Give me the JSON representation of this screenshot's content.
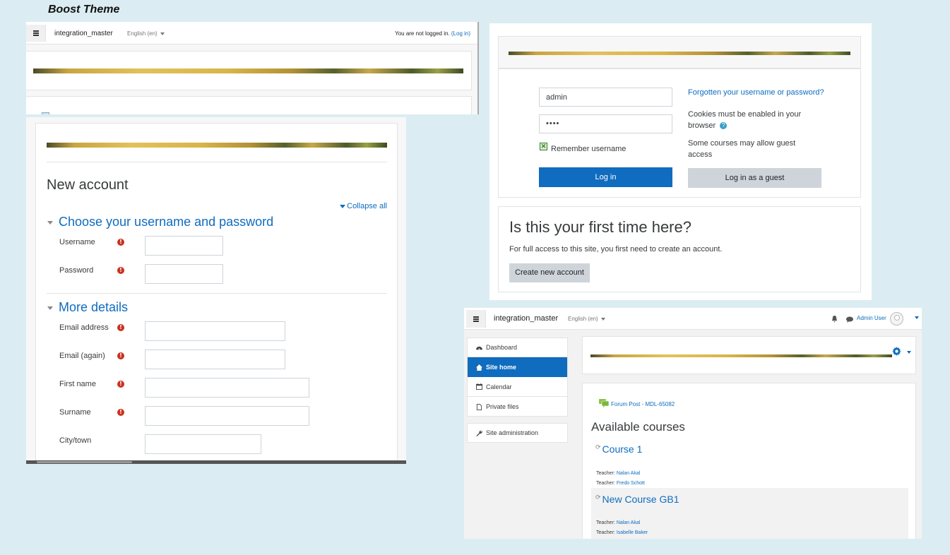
{
  "page_title": "Boost Theme",
  "top_left": {
    "site_name": "integration_master",
    "language": "English (en)",
    "not_logged": "You are not logged in.",
    "login_link": "(Log in)"
  },
  "signup": {
    "heading": "New account",
    "collapse_all": "Collapse all",
    "section1": "Choose your username and password",
    "section2": "More details",
    "fields1": [
      {
        "label": "Username",
        "required": true
      },
      {
        "label": "Password",
        "required": true
      }
    ],
    "fields2": [
      {
        "label": "Email address",
        "required": true
      },
      {
        "label": "Email (again)",
        "required": true
      },
      {
        "label": "First name",
        "required": true
      },
      {
        "label": "Surname",
        "required": true
      },
      {
        "label": "City/town",
        "required": false
      }
    ]
  },
  "login": {
    "username_value": "admin",
    "password_value": "••••",
    "remember": "Remember username",
    "login_button": "Log in",
    "guest_button": "Log in as a guest",
    "forgot_link": "Forgotten your username or password?",
    "cookies_line1": "Cookies must be enabled in your",
    "cookies_line2": "browser",
    "guest_note_line1": "Some courses may allow guest",
    "guest_note_line2": "access",
    "first_time_heading": "Is this your first time here?",
    "first_time_text": "For full access to this site, you first need to create an account.",
    "create_button": "Create new account"
  },
  "dashboard": {
    "site_name": "integration_master",
    "language": "English (en)",
    "user_name": "Admin User",
    "nav": [
      {
        "label": "Dashboard",
        "icon": "dashboard-icon",
        "active": false
      },
      {
        "label": "Site home",
        "icon": "home-icon",
        "active": true
      },
      {
        "label": "Calendar",
        "icon": "calendar-icon",
        "active": false
      },
      {
        "label": "Private files",
        "icon": "file-icon",
        "active": false
      }
    ],
    "site_admin": "Site administration",
    "forum_post": "Forum Post - MDL-65082",
    "available_courses": "Available courses",
    "teacher_label": "Teacher:",
    "courses": [
      {
        "name": "Course 1",
        "teachers": [
          "Nalan Akal",
          "Fredo Schott"
        ]
      },
      {
        "name": "New Course GB1",
        "teachers": [
          "Nalan Akal",
          "Isabelle Baker"
        ]
      }
    ]
  },
  "colors": {
    "accent": "#0f6cbf",
    "background": "#dbedf3",
    "required": "#ca3120"
  }
}
